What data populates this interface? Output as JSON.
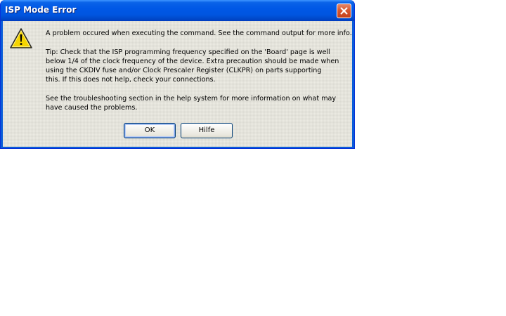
{
  "window": {
    "title": "ISP Mode Error",
    "close_icon": "close-icon"
  },
  "icon": {
    "name": "warning-icon",
    "color": "#f5d400"
  },
  "message": {
    "line1": "A problem occured when executing the command. See the command output for more info.",
    "tip_lines": [
      "Tip: Check that the ISP programming frequency specified on the 'Board' page is well",
      "below 1/4 of the clock frequency of the device. Extra precaution should be made when",
      "using the CKDIV fuse and/or Clock Prescaler Register (CLKPR) on parts supporting",
      "this. If this does not help, check your connections."
    ],
    "help_lines": [
      "See the troubleshooting section in the help system for more information on what may",
      "have caused the problems."
    ]
  },
  "buttons": {
    "ok_label": "OK",
    "help_label": "Hilfe"
  },
  "colors": {
    "titlebar": "#0058e6",
    "close_button": "#d8582f",
    "dialog_background": "#ecebe3"
  }
}
